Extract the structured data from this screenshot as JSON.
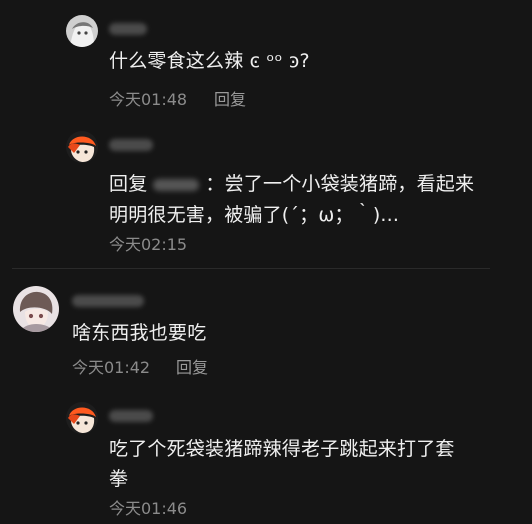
{
  "comments": [
    {
      "text": "什么零食这么辣 ͼ ᵒᵒ ͽ?",
      "time": "今天01:48",
      "reply_label": "回复"
    },
    {
      "reply_prefix": "回复",
      "text_line1": "：尝了一个小袋装猪蹄，看起来",
      "text_line2": "明明很无害，被骗了(´；ω；｀)...",
      "time": "今天02:15"
    },
    {
      "text": "啥东西我也要吃",
      "time": "今天01:42",
      "reply_label": "回复"
    },
    {
      "text_line1": "吃了个死袋装猪蹄辣得老子跳起来打了套",
      "text_line2": "拳",
      "time": "今天01:46"
    }
  ],
  "colors": {
    "background": "#151515",
    "text": "#efefef",
    "meta": "#8b8b8b"
  },
  "icons": [
    "avatar-grey-anime",
    "avatar-orange-hair",
    "avatar-anime-boy",
    "avatar-orange-hair"
  ]
}
